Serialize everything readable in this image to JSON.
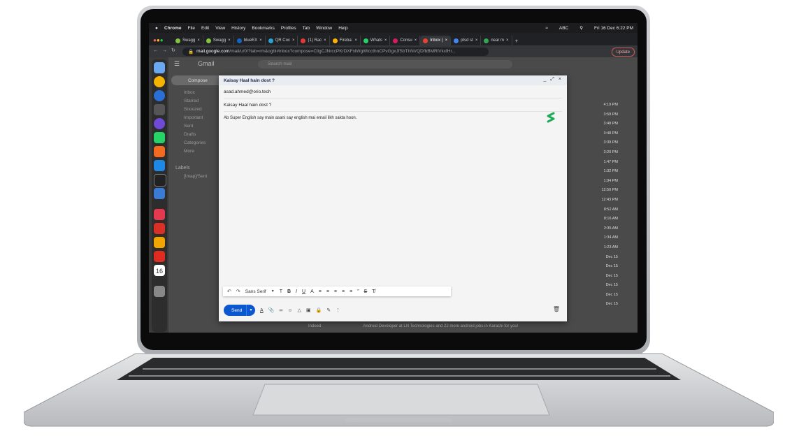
{
  "menubar": {
    "apple": "",
    "app": "Chrome",
    "items": [
      "File",
      "Edit",
      "View",
      "History",
      "Bookmarks",
      "Profiles",
      "Tab",
      "Window",
      "Help"
    ],
    "abc": "ABC",
    "datetime": "Fri 16 Dec 6:22 PM"
  },
  "tabs": [
    {
      "label": "Swagg",
      "color": "#85c341"
    },
    {
      "label": "Swagg",
      "color": "#85c341"
    },
    {
      "label": "blueEX",
      "color": "#1565c0"
    },
    {
      "label": "QR Coc",
      "color": "#29a3d6"
    },
    {
      "label": "(1) Rac",
      "color": "#e53935"
    },
    {
      "label": "Fireba:",
      "color": "#ffb300"
    },
    {
      "label": "Whats",
      "color": "#25d366"
    },
    {
      "label": "Consu",
      "color": "#d81b60"
    },
    {
      "label": "Inbox (",
      "color": "#ea4335"
    },
    {
      "label": "ptsd st",
      "color": "#4285f4"
    },
    {
      "label": "near m",
      "color": "#34a853"
    }
  ],
  "new_tab": "+",
  "address": {
    "host": "mail.google.com",
    "path": "/mail/u/0/?tab=rm&ogbl#inbox?compose=CllgCJNrccPKrDXFxlWgWlccthnCPvGgxJfSbThNVQDfbBMRlVkxfHr..."
  },
  "update_label": "Update",
  "gmail": {
    "logo": "Gmail",
    "search_placeholder": "Search mail",
    "compose_button": "Compose",
    "nav": [
      "Inbox",
      "Starred",
      "Snoozed",
      "Important",
      "Sent",
      "Drafts",
      "Categories",
      "More"
    ],
    "labels_heading": "Labels",
    "label_item": "[Imap]/Sent",
    "times": [
      "4:19 PM",
      "3:59 PM",
      "3:48 PM",
      "3:48 PM",
      "3:39 PM",
      "3:20 PM",
      "1:47 PM",
      "1:32 PM",
      "1:04 PM",
      "12:50 PM",
      "12:43 PM",
      "8:52 AM",
      "8:16 AM",
      "2:35 AM",
      "1:34 AM",
      "1:23 AM",
      "Dec 15",
      "Dec 15",
      "Dec 15",
      "Dec 15",
      "Dec 15",
      "Dec 15"
    ],
    "bottom_sender": "Indeed",
    "bottom_snippet": "Android Developer at LN Technologies and 22 more android jobs in Karachi for you!"
  },
  "compose": {
    "title": "Kaisay Haal hain dost ?",
    "to": "asad.ahmed@orio.tech",
    "subject": "Kaisay Haal hain dost ?",
    "body": "Ab Super English say main asani say english mai email likh sakta hoon.",
    "font": "Sans Serif",
    "send_label": "Send"
  },
  "colors": {
    "send": "#0b57d0",
    "compose_header": "#e9ecf1",
    "menubar": "#1c1c1e"
  }
}
